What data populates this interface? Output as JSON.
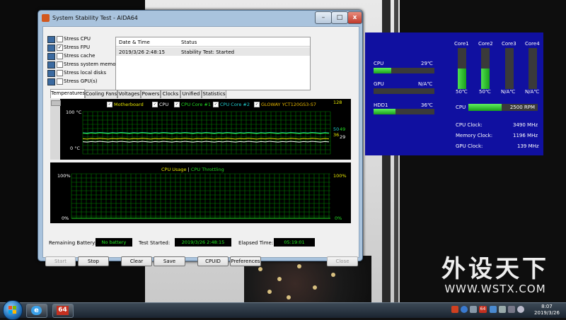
{
  "window": {
    "title": "System Stability Test - AIDA64",
    "controls": {
      "minimize": "–",
      "maximize": "□",
      "close": "x"
    }
  },
  "stress": [
    {
      "label": "Stress CPU",
      "checked": false,
      "icon": "cpu-icon"
    },
    {
      "label": "Stress FPU",
      "checked": true,
      "icon": "fpu-icon"
    },
    {
      "label": "Stress cache",
      "checked": false,
      "icon": "cache-icon"
    },
    {
      "label": "Stress system memory",
      "checked": false,
      "icon": "memory-icon"
    },
    {
      "label": "Stress local disks",
      "checked": false,
      "icon": "disk-icon"
    },
    {
      "label": "Stress GPU(s)",
      "checked": false,
      "icon": "gpu-icon"
    }
  ],
  "log": {
    "col_date": "Date & Time",
    "col_status": "Status",
    "rows": [
      {
        "date": "2019/3/26 2:48:15",
        "status": "Stability Test: Started"
      }
    ]
  },
  "tabs": [
    "Temperatures",
    "Cooling Fans",
    "Voltages",
    "Powers",
    "Clocks",
    "Unified",
    "Statistics"
  ],
  "temp_graph": {
    "legend": [
      {
        "label": "Motherboard",
        "color": "#e8e800"
      },
      {
        "label": "CPU",
        "color": "#ffffff"
      },
      {
        "label": "CPU Core #1",
        "color": "#22dd22"
      },
      {
        "label": "CPU Core #2",
        "color": "#22d0d0"
      },
      {
        "label": "GLOWAY YCT120GS3-S7",
        "color": "#e8b800"
      }
    ],
    "y_top": "100 °C",
    "y_bottom": "0 °C",
    "top_right": "128",
    "readouts": [
      "50",
      "49",
      "36",
      "29"
    ]
  },
  "usage_graph": {
    "title_usage": "CPU Usage",
    "separator": "|",
    "title_throttle": "CPU Throttling",
    "y_top": "100%",
    "y_bottom": "0%",
    "r_top": "100%",
    "r_bottom": "0%"
  },
  "status": {
    "battery_label": "Remaining Battery:",
    "battery_value": "No battery",
    "started_label": "Test Started:",
    "started_value": "2019/3/26 2:48:15",
    "elapsed_label": "Elapsed Time:",
    "elapsed_value": "05:19:01"
  },
  "buttons": {
    "start": "Start",
    "stop": "Stop",
    "clear": "Clear",
    "save": "Save",
    "cpuid": "CPUID",
    "preferences": "Preferences",
    "close": "Close"
  },
  "sensor_panel": {
    "core_headers": [
      "Core1",
      "Core2",
      "Core3",
      "Core4"
    ],
    "core_values": [
      "50℃",
      "50℃",
      "N/A℃",
      "N/A℃"
    ],
    "core_levels": [
      0.5,
      0.5,
      0,
      0
    ],
    "cpu_label": "CPU",
    "cpu_temp": "29℃",
    "cpu_level": 0.29,
    "gpu_label": "GPU",
    "gpu_temp": "N/A℃",
    "gpu_level": 0,
    "hdd_label": "HDD1",
    "hdd_temp": "36℃",
    "hdd_level": 0.36,
    "fan_label": "CPU",
    "fan_value": "2500 RPM",
    "fan_level": 0.48,
    "cpu_clock_label": "CPU Clock:",
    "cpu_clock_value": "3490 MHz",
    "mem_clock_label": "Memory Clock:",
    "mem_clock_value": "1196 MHz",
    "gpu_clock_label": "GPU Clock:",
    "gpu_clock_value": "139 MHz"
  },
  "watermark": {
    "big": "外设天下",
    "small": "WWW.WSTX.COM"
  },
  "taskbar": {
    "aida_badge": "64",
    "ie_glyph": "e",
    "tray_badge": "64",
    "time": "8:07",
    "date": "2019/3/26"
  },
  "colors": {
    "panel_bg": "#1010a0",
    "graph_green": "#00a000",
    "status_green": "#22ee22"
  }
}
